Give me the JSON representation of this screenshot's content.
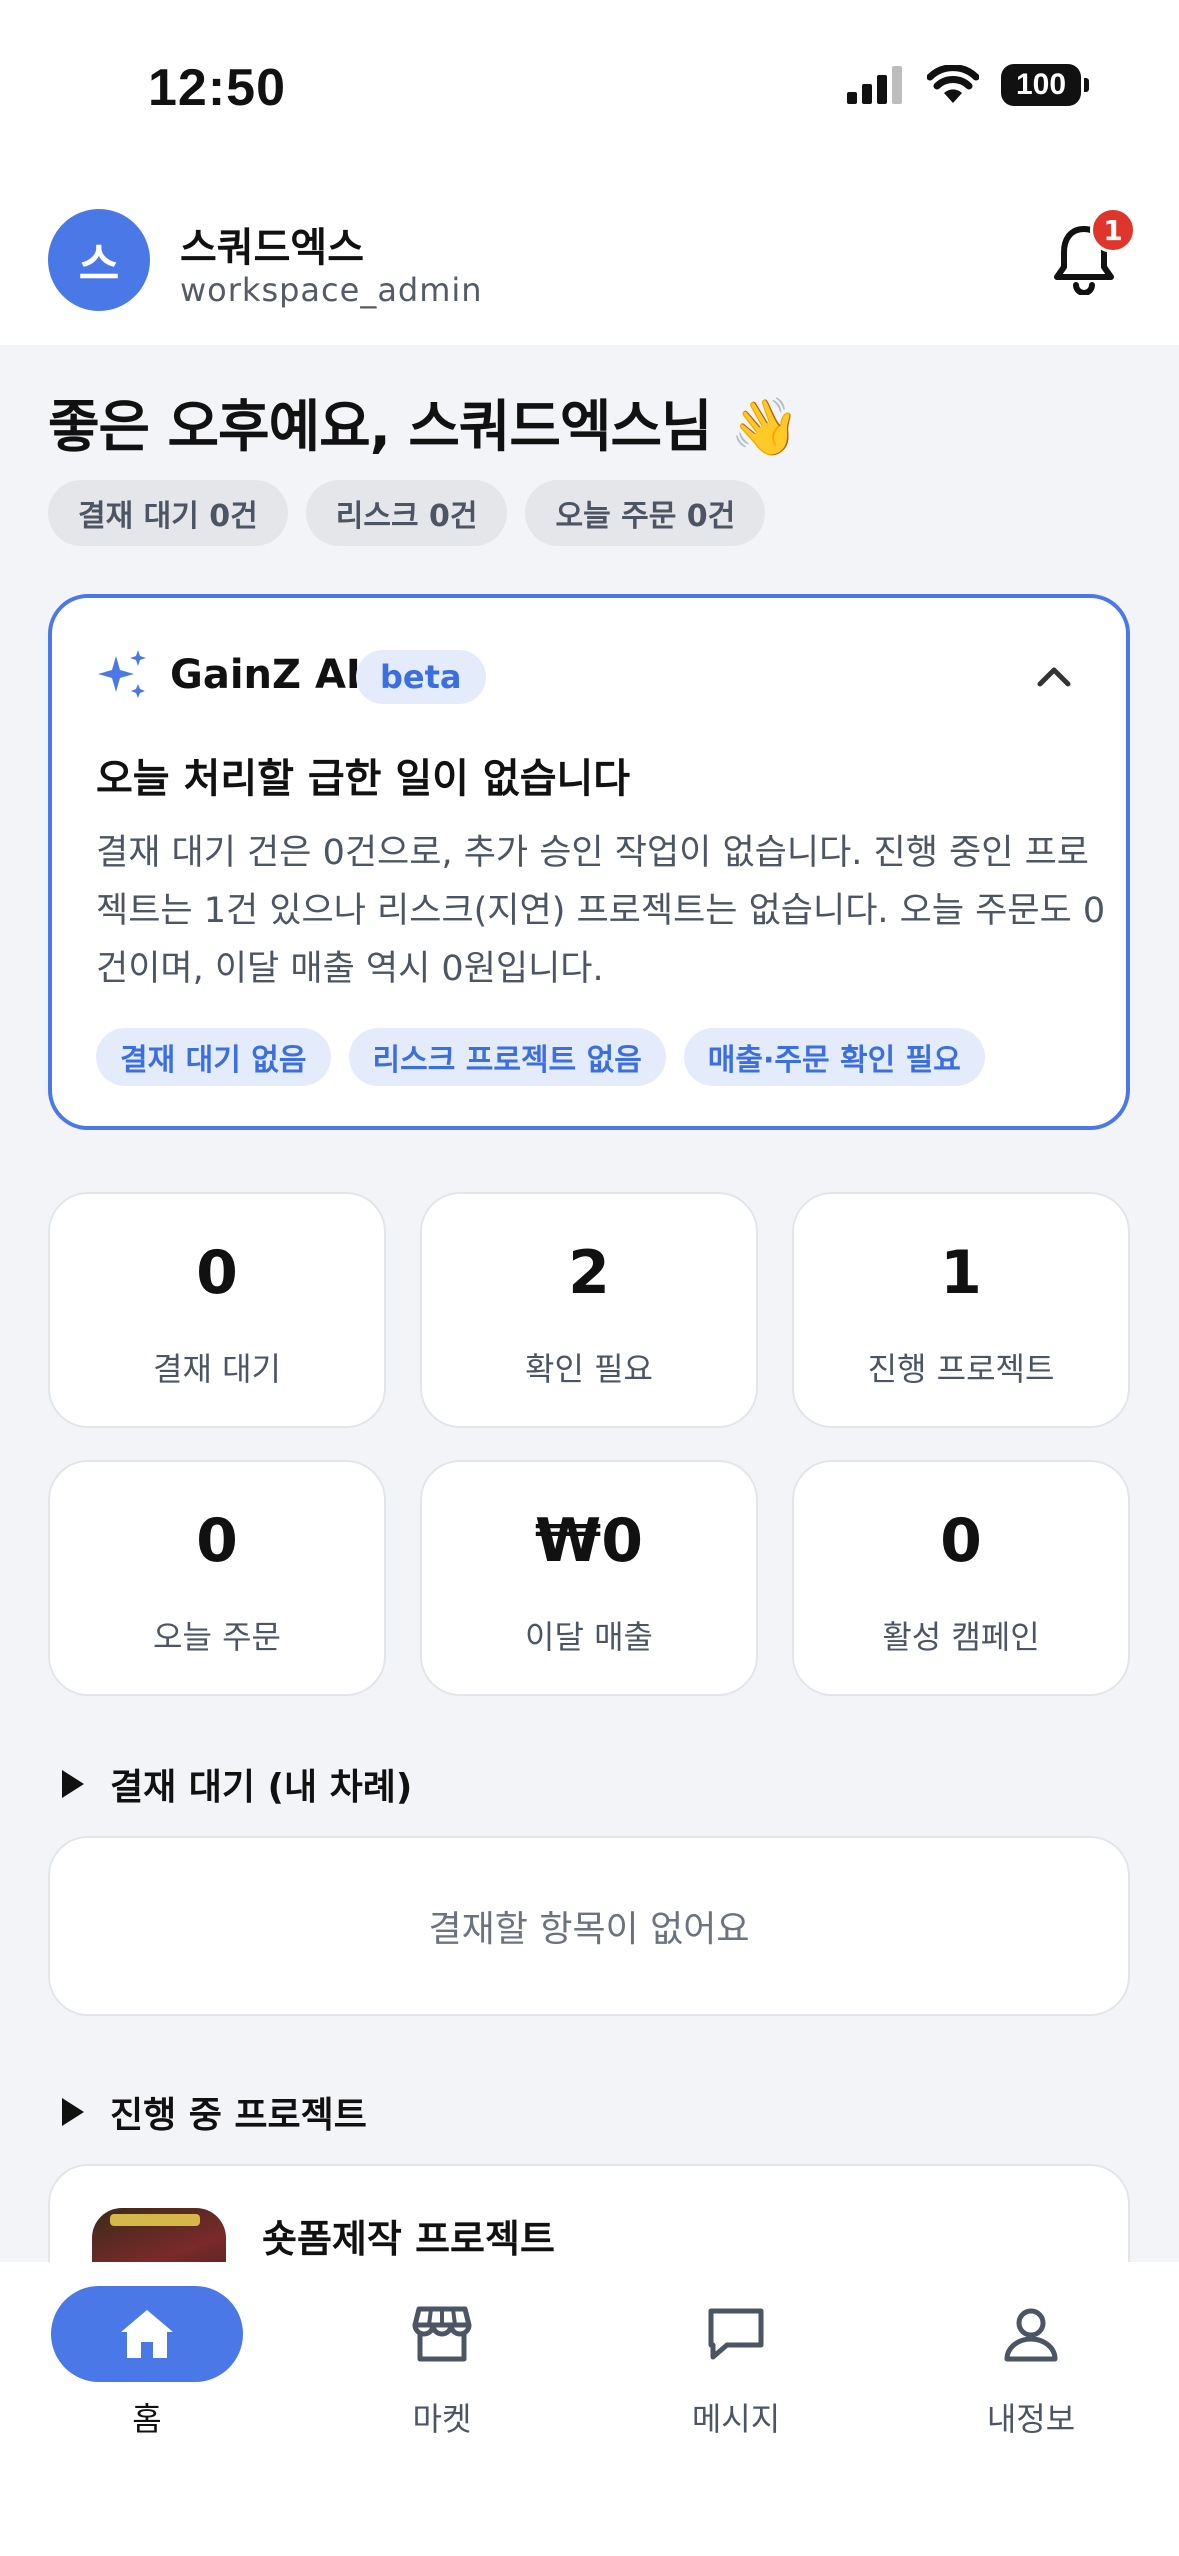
{
  "status_bar": {
    "time": "12:50",
    "battery": "100"
  },
  "header": {
    "avatar_initial": "스",
    "workspace_name": "스쿼드엑스",
    "workspace_role": "workspace_admin",
    "notification_count": "1"
  },
  "greeting": "좋은 오후예요, 스쿼드엑스님 👋",
  "summary_chips": [
    "결재 대기 0건",
    "리스크 0건",
    "오늘 주문 0건"
  ],
  "ai_card": {
    "title": "GainZ AI",
    "badge": "beta",
    "headline": "오늘 처리할 급한 일이 없습니다",
    "body": "결재 대기 건은 0건으로, 추가 승인 작업이 없습니다. 진행 중인 프로젝트는 1건 있으나 리스크(지연) 프로젝트는 없습니다. 오늘 주문도 0건이며, 이달 매출 역시 0원입니다.",
    "tags": [
      "결재 대기 없음",
      "리스크 프로젝트 없음",
      "매출·주문 확인 필요"
    ]
  },
  "stats": [
    {
      "value": "0",
      "label": "결재 대기"
    },
    {
      "value": "2",
      "label": "확인 필요"
    },
    {
      "value": "1",
      "label": "진행 프로젝트"
    },
    {
      "value": "0",
      "label": "오늘 주문"
    },
    {
      "value": "₩0",
      "label": "이달 매출"
    },
    {
      "value": "0",
      "label": "활성 캠페인"
    }
  ],
  "approvals_section": {
    "title": "결재 대기 (내 차례)",
    "empty_text": "결재할 항목이 없어요"
  },
  "projects_section": {
    "title": "진행 중 프로젝트",
    "items": [
      {
        "name": "숏폼제작 프로젝트"
      }
    ]
  },
  "tabbar": {
    "items": [
      {
        "label": "홈",
        "icon": "home-icon",
        "active": true
      },
      {
        "label": "마켓",
        "icon": "store-icon",
        "active": false
      },
      {
        "label": "메시지",
        "icon": "message-icon",
        "active": false
      },
      {
        "label": "내정보",
        "icon": "user-icon",
        "active": false
      }
    ]
  },
  "colors": {
    "accent": "#4A78E6",
    "badge": "#E0352B",
    "background": "#F2F4F7"
  }
}
